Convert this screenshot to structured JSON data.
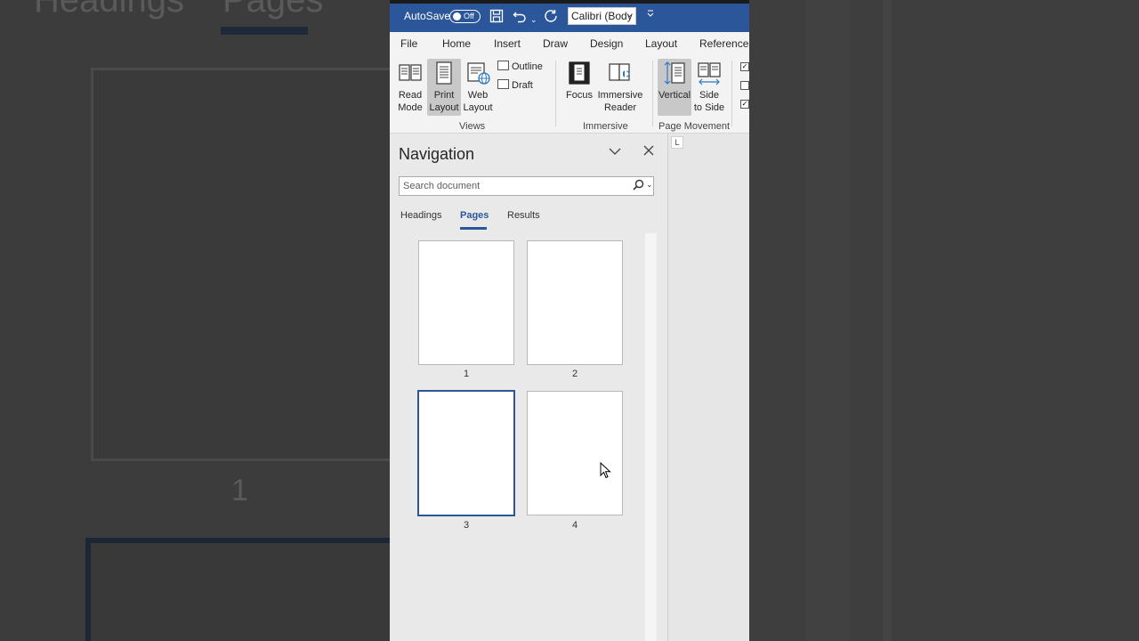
{
  "background": {
    "tabs": [
      "Headings",
      "Pages"
    ],
    "page_number": "1"
  },
  "titlebar": {
    "autosave_label": "AutoSave",
    "autosave_state": "Off",
    "font_name": "Calibri (Body"
  },
  "menu": {
    "items": [
      "File",
      "Home",
      "Insert",
      "Draw",
      "Design",
      "Layout",
      "References"
    ]
  },
  "ribbon": {
    "read_mode": [
      "Read",
      "Mode"
    ],
    "print_layout": [
      "Print",
      "Layout"
    ],
    "web_layout": [
      "Web",
      "Layout"
    ],
    "outline": "Outline",
    "draft": "Draft",
    "views_group": "Views",
    "focus": "Focus",
    "immersive_reader": [
      "Immersive",
      "Reader"
    ],
    "immersive_group": "Immersive",
    "vertical": "Vertical",
    "side_to_side": [
      "Side",
      "to Side"
    ],
    "page_movement_group": "Page Movement"
  },
  "navigation": {
    "title": "Navigation",
    "search_placeholder": "Search document",
    "tabs": [
      {
        "label": "Headings",
        "active": false
      },
      {
        "label": "Pages",
        "active": true
      },
      {
        "label": "Results",
        "active": false
      }
    ],
    "pages": [
      {
        "number": "1",
        "selected": false
      },
      {
        "number": "2",
        "selected": false
      },
      {
        "number": "3",
        "selected": true
      },
      {
        "number": "4",
        "selected": false
      }
    ]
  },
  "ruler": {
    "tab_marker": "L"
  },
  "colors": {
    "accent": "#2b579a",
    "titlebar": "#2b579a",
    "pane_bg": "#e9e9e9"
  }
}
